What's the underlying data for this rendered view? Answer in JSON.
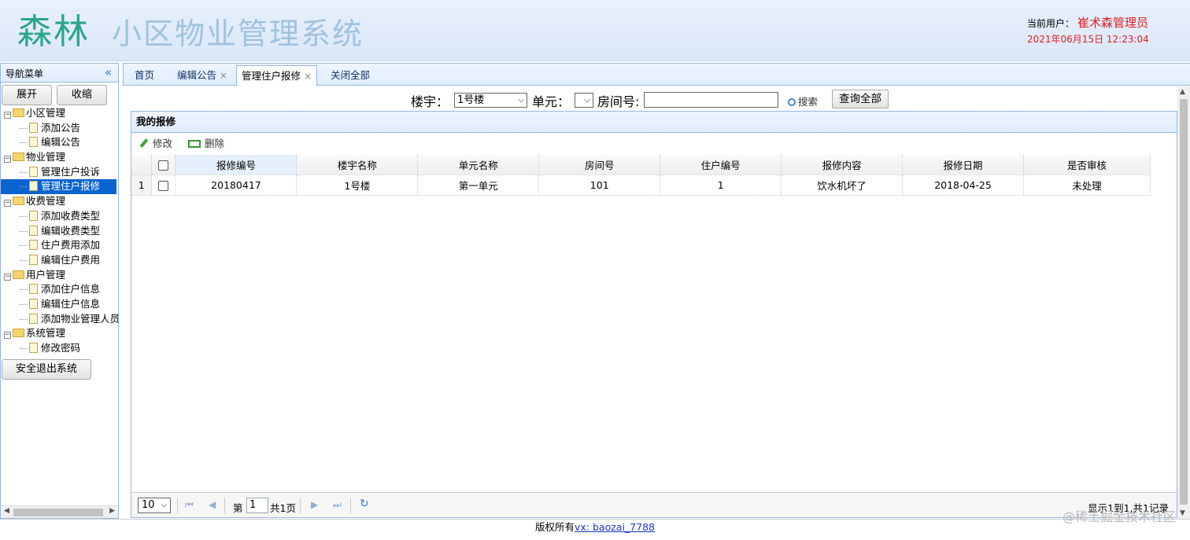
{
  "header": {
    "logo": "森林",
    "title": "小区物业管理系统",
    "current_user_label": "当前用户：",
    "user_name": "崔术森管理员",
    "datetime": "2021年06月15日 12:23:04"
  },
  "sidebar": {
    "title": "导航菜单",
    "expand_label": "展开",
    "collapse_label": "收缩",
    "groups": [
      {
        "label": "小区管理",
        "items": [
          "添加公告",
          "编辑公告"
        ]
      },
      {
        "label": "物业管理",
        "items": [
          "管理住户投诉",
          "管理住户报修"
        ]
      },
      {
        "label": "收费管理",
        "items": [
          "添加收费类型",
          "编辑收费类型",
          "住户费用添加",
          "编辑住户费用"
        ]
      },
      {
        "label": "用户管理",
        "items": [
          "添加住户信息",
          "编辑住户信息",
          "添加物业管理人员"
        ]
      },
      {
        "label": "系统管理",
        "items": [
          "修改密码"
        ]
      }
    ],
    "active_item": "管理住户报修",
    "exit_label": "安全退出系统"
  },
  "tabs": [
    {
      "label": "首页",
      "closable": false
    },
    {
      "label": "编辑公告",
      "closable": true
    },
    {
      "label": "管理住户报修",
      "closable": true,
      "active": true
    },
    {
      "label": "关闭全部",
      "closable": false
    }
  ],
  "search": {
    "building_label": "楼宇：",
    "building_value": "1号楼",
    "unit_label": "单元：",
    "unit_value": "",
    "room_label": "房间号:",
    "room_value": "",
    "search_label": "搜索",
    "query_all_label": "查询全部"
  },
  "panel": {
    "title": "我的报修",
    "edit_label": "修改",
    "delete_label": "删除"
  },
  "table": {
    "columns": [
      "报修编号",
      "楼宇名称",
      "单元名称",
      "房间号",
      "住户编号",
      "报修内容",
      "报修日期",
      "是否审核"
    ],
    "rows": [
      {
        "num": "1",
        "cells": [
          "20180417",
          "1号楼",
          "第一单元",
          "101",
          "1",
          "饮水机坏了",
          "2018-04-25",
          "未处理"
        ]
      }
    ]
  },
  "pager": {
    "page_size": "10",
    "page_prefix": "第",
    "page_value": "1",
    "page_suffix": "共1页",
    "info": "显示1到1,共1记录"
  },
  "footer": {
    "copyright": "版权所有",
    "contact": "vx: baozai_7788"
  },
  "watermark": "@稀土掘金技术社区"
}
